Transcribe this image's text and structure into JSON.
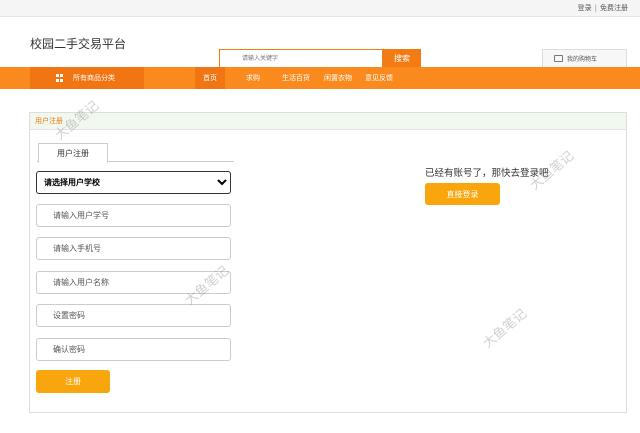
{
  "topbar": {
    "login": "登录",
    "separator": "|",
    "register": "免费注册"
  },
  "header": {
    "site_title": "校园二手交易平台",
    "search_placeholder": "请输入关键字",
    "search_button": "搜索",
    "cart_label": "我的购物车",
    "cart_icon": "cart-icon"
  },
  "nav": {
    "category_label": "所有商品分类",
    "category_icon": "grid-icon",
    "items": [
      {
        "label": "首页",
        "active": true
      },
      {
        "label": "求购"
      },
      {
        "label": "生活百货"
      },
      {
        "label": "闲置衣物"
      },
      {
        "label": "意见反馈"
      }
    ]
  },
  "panel": {
    "title": "用户注册",
    "tab_label": "用户注册",
    "school_select": "请选择用户学校",
    "fields": {
      "student_id": "请输入用户学号",
      "phone": "请输入手机号",
      "username": "请输入用户名称",
      "password": "设置密码",
      "confirm": "确认密码"
    },
    "register_button": "注册",
    "has_account_text": "已经有账号了，那快去登录吧",
    "login_button": "直接登录"
  },
  "watermark": "大鱼笔记",
  "colors": {
    "accent": "#fb8a1e",
    "accent_dark": "#f27514",
    "button": "#f9a50d"
  }
}
